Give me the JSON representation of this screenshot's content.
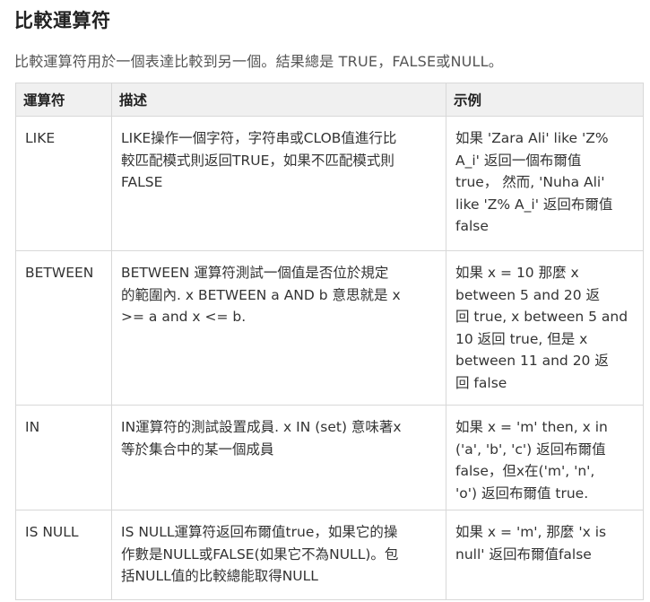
{
  "page": {
    "title": "比較運算符",
    "intro": "比較運算符用於一個表達比較到另一個。結果總是 TRUE，FALSE或NULL。"
  },
  "table": {
    "headers": [
      "運算符",
      "描述",
      "示例"
    ],
    "rows": [
      {
        "operator": "LIKE",
        "description": [
          "LIKE操作一個字符，字符串或CLOB值進行比",
          "較匹配模式則返回TRUE，如果不匹配模式則",
          "FALSE"
        ],
        "example": [
          "如果 'Zara Ali' like 'Z%",
          "A_i' 返回一個布爾值",
          "true， 然而, 'Nuha Ali'",
          "like 'Z% A_i' 返回布爾值",
          "false"
        ]
      },
      {
        "operator": "BETWEEN",
        "description": [
          "BETWEEN 運算符測試一個值是否位於規定",
          "的範圍內. x BETWEEN a AND b 意思就是 x",
          ">= a and x <= b."
        ],
        "example": [
          "如果 x = 10 那麼  x",
          "between 5 and 20 返",
          "回 true, x between 5 and",
          "10 返回 true, 但是 x",
          "between 11 and 20 返",
          "回 false"
        ]
      },
      {
        "operator": "IN",
        "description": [
          "IN運算符的測試設置成員. x IN (set) 意味著x",
          "等於集合中的某一個成員"
        ],
        "example": [
          "如果  x = 'm' then, x in",
          "('a', 'b', 'c') 返回布爾值",
          "false，但x在('m', 'n',",
          "'o') 返回布爾值 true."
        ]
      },
      {
        "operator": "IS NULL",
        "description": [
          "IS NULL運算符返回布爾值true，如果它的操",
          "作數是NULL或FALSE(如果它不為NULL)。包",
          "括NULL值的比較總能取得NULL"
        ],
        "example": [
          "如果  x = 'm', 那麼 'x is",
          "null' 返回布爾值false"
        ]
      }
    ]
  }
}
